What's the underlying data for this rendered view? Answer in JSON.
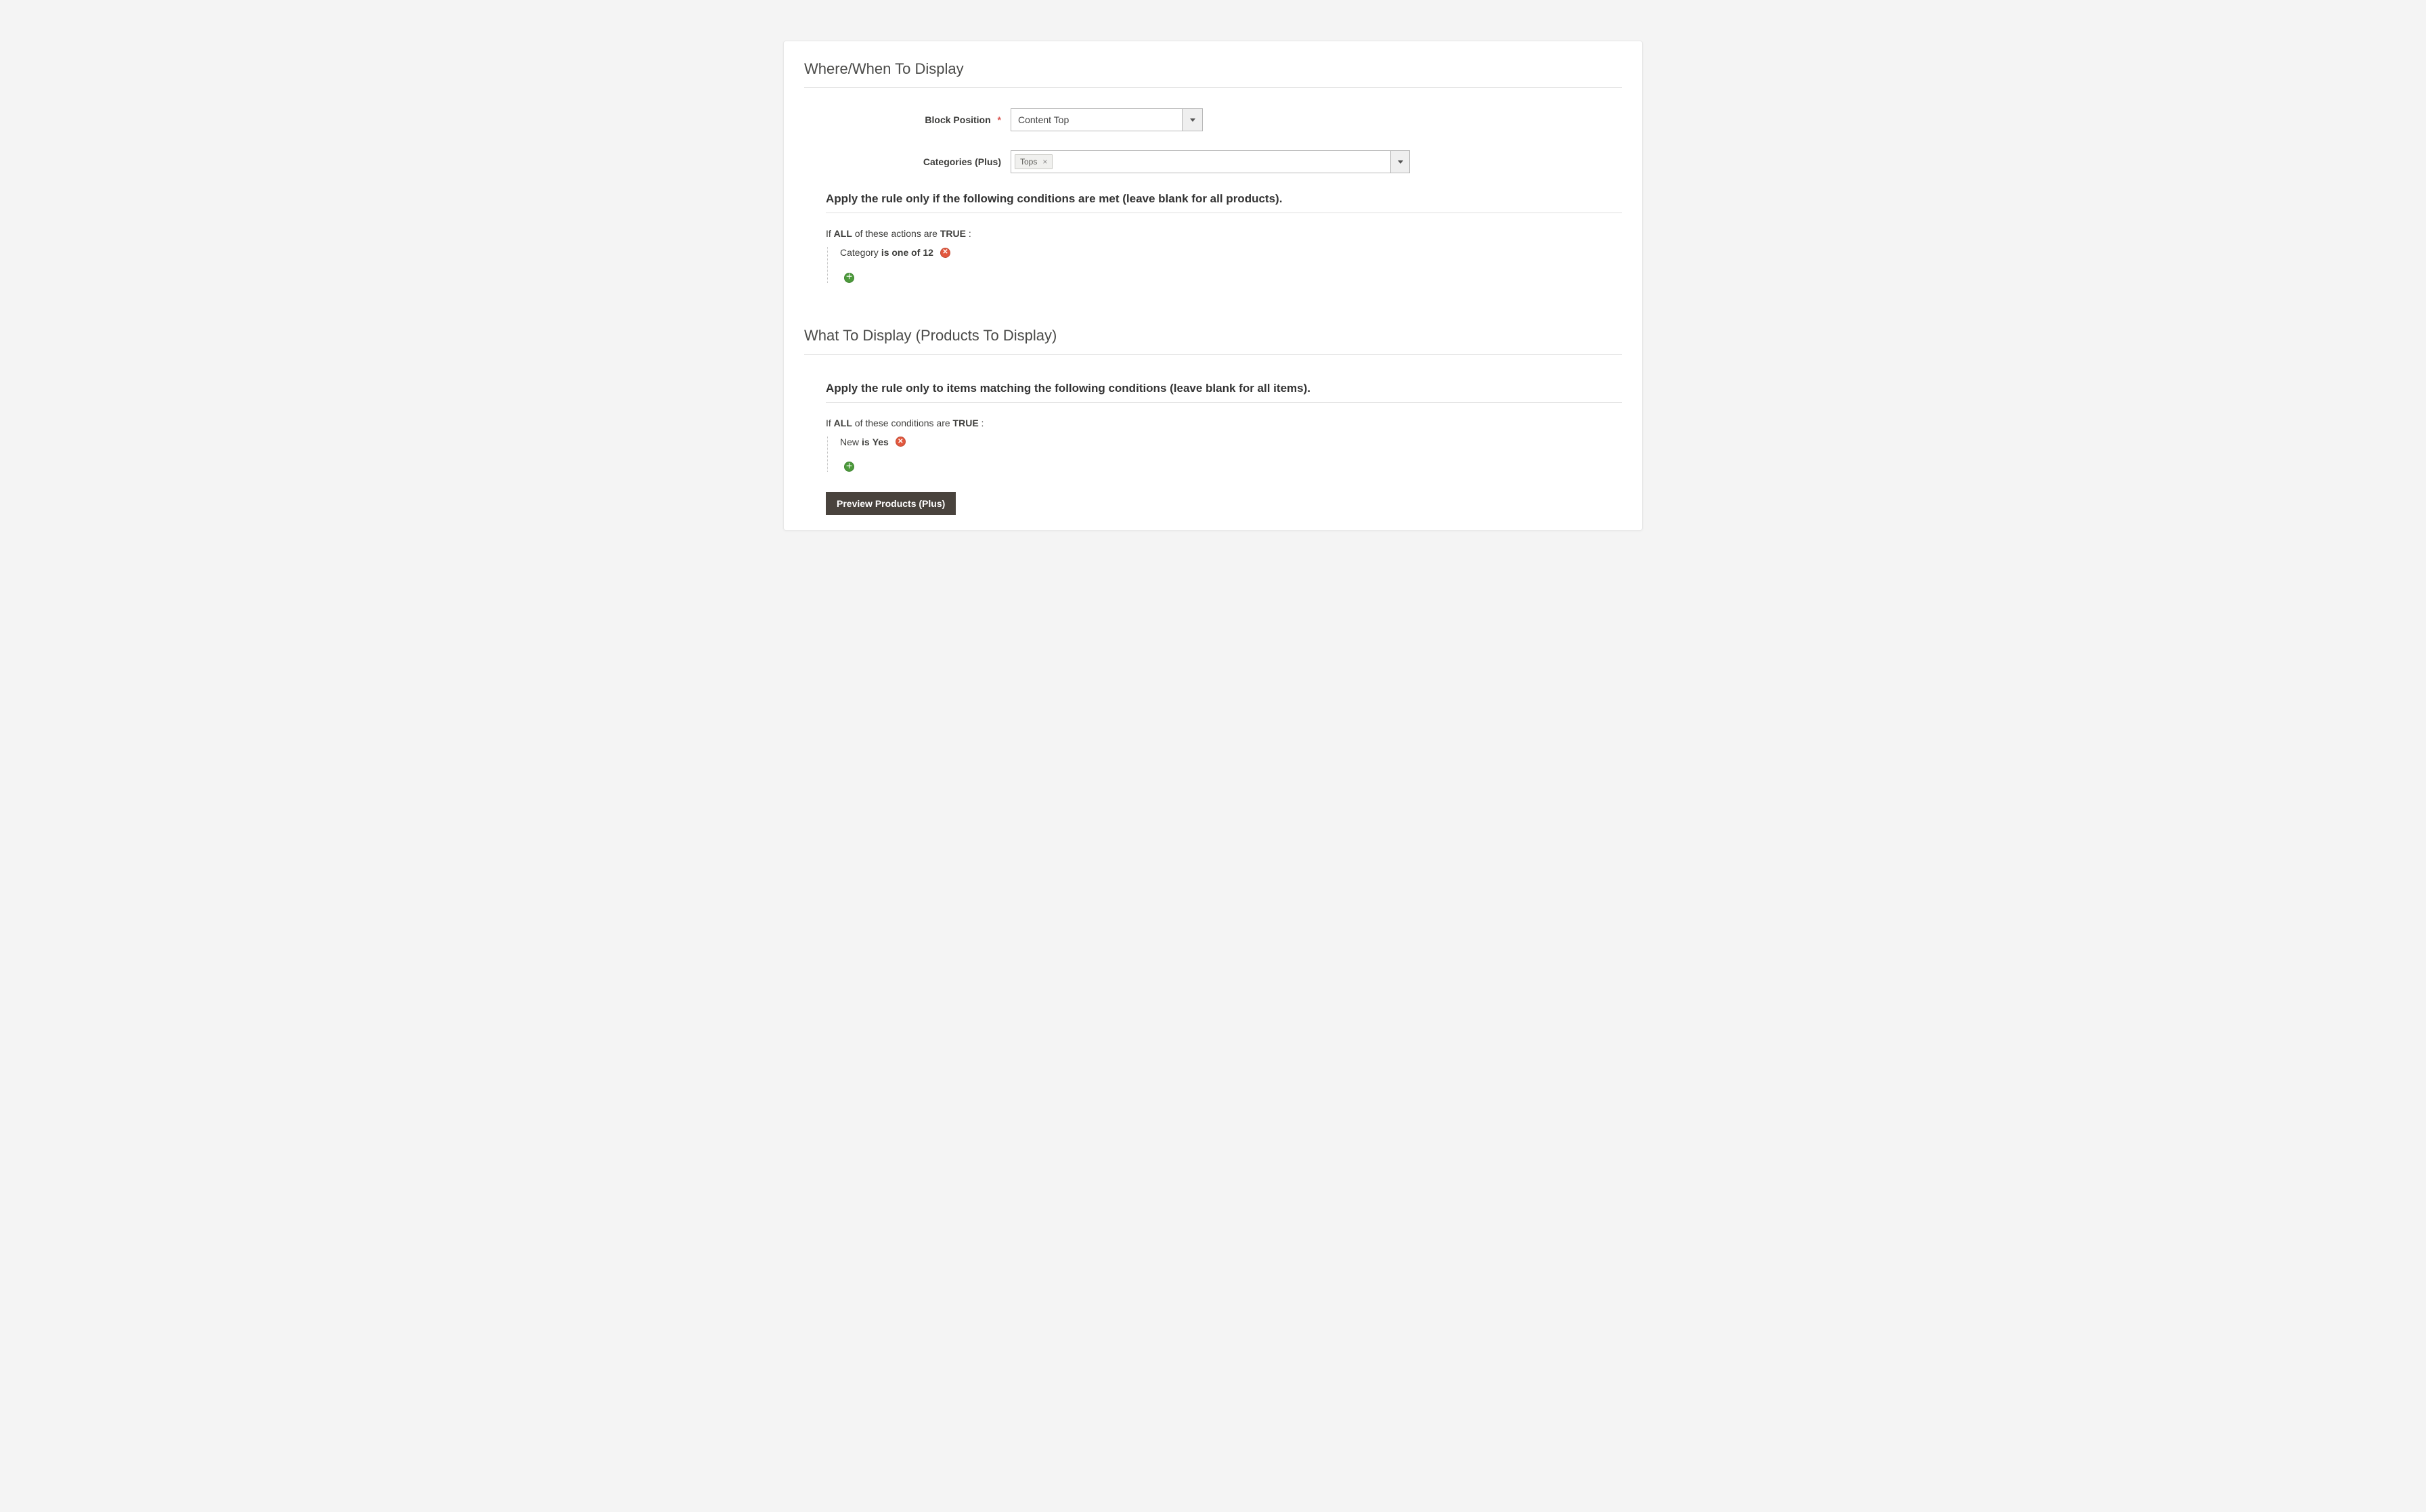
{
  "section1": {
    "title": "Where/When To Display",
    "block_position": {
      "label": "Block Position",
      "required_mark": "*",
      "value": "Content Top"
    },
    "categories": {
      "label": "Categories (Plus)",
      "chip": "Tops"
    },
    "rule": {
      "heading": "Apply the rule only if the following conditions are met (leave blank for all products).",
      "sentence_pre": "If ",
      "sentence_agg": "ALL",
      "sentence_mid": "  of these actions are ",
      "sentence_val": "TRUE",
      "sentence_post": " :",
      "cond_attr": "Category ",
      "cond_op": " is one of ",
      "cond_val": " 12"
    }
  },
  "section2": {
    "title": "What To Display (Products To Display)",
    "rule": {
      "heading": "Apply the rule only to items matching the following conditions (leave blank for all items).",
      "sentence_pre": "If ",
      "sentence_agg": "ALL",
      "sentence_mid": "  of these conditions are ",
      "sentence_val": "TRUE",
      "sentence_post": " :",
      "cond_attr": "New ",
      "cond_op": " is ",
      "cond_val": " Yes"
    },
    "preview_button": "Preview Products (Plus)"
  }
}
